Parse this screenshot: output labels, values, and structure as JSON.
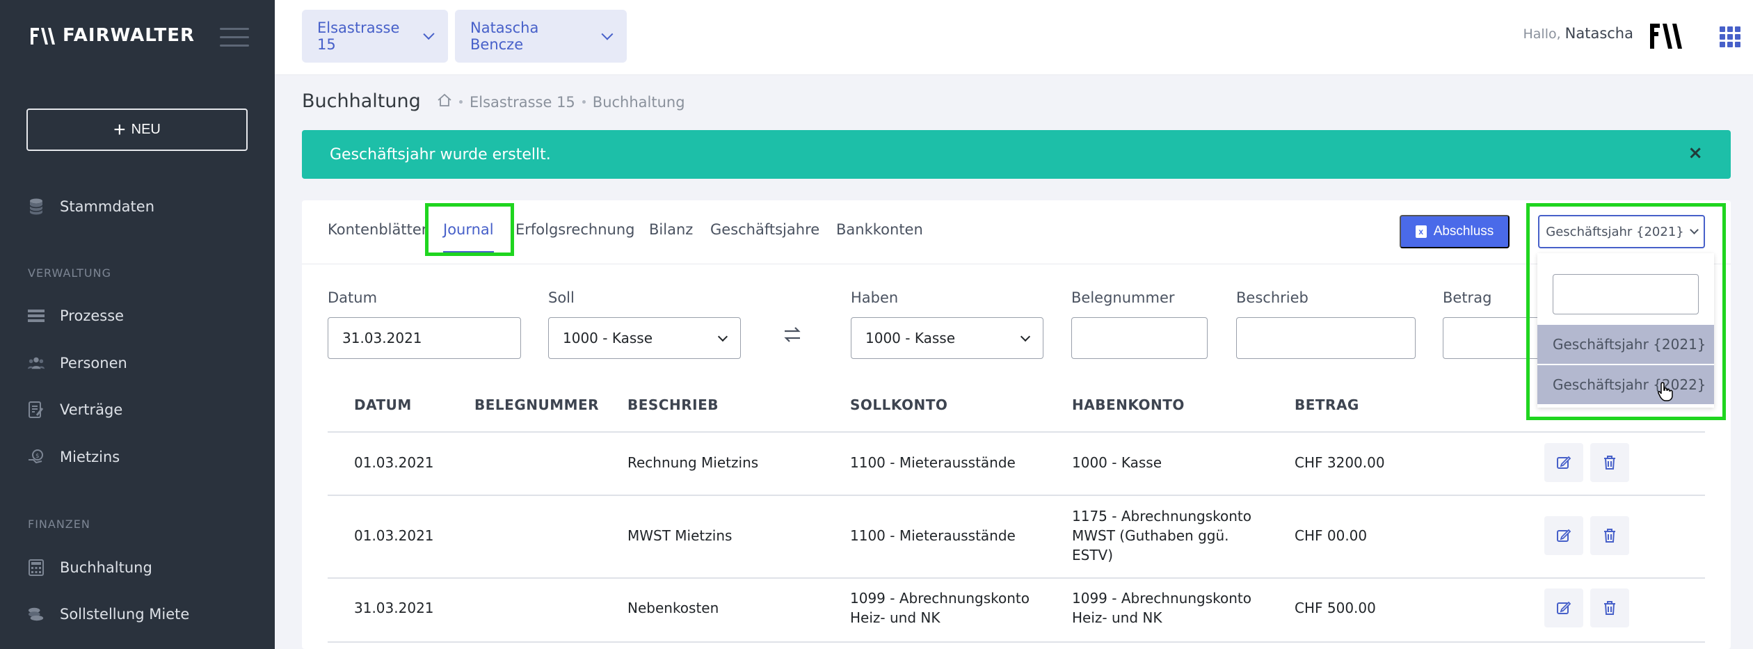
{
  "sidebar": {
    "logo": "FAIRWALTER",
    "new_label": "NEU",
    "items": [
      {
        "label": "Stammdaten",
        "icon": "database-icon"
      },
      {
        "label": "Prozesse",
        "icon": "list-icon"
      },
      {
        "label": "Personen",
        "icon": "people-icon"
      },
      {
        "label": "Verträge",
        "icon": "contract-icon"
      },
      {
        "label": "Mietzins",
        "icon": "coin-hand-icon"
      },
      {
        "label": "Buchhaltung",
        "icon": "calculator-icon"
      },
      {
        "label": "Sollstellung Miete",
        "icon": "coins-icon"
      }
    ],
    "sections": {
      "verwaltung": "VERWALTUNG",
      "finanzen": "FINANZEN"
    }
  },
  "topbar": {
    "property_select": "Elsastrasse 15",
    "person_select": "Natascha Bencze",
    "greeting": "Hallo,",
    "user_name": "Natascha"
  },
  "page": {
    "title": "Buchhaltung",
    "breadcrumb": [
      "Elsastrasse 15",
      "Buchhaltung"
    ]
  },
  "alert": {
    "message": "Geschäftsjahr wurde erstellt.",
    "close": "×",
    "color": "#1dbfa8"
  },
  "tabs": [
    "Kontenblätter",
    "Journal",
    "Erfolgsrechnung",
    "Bilanz",
    "Geschäftsjahre",
    "Bankkonten"
  ],
  "active_tab": "Journal",
  "actions": {
    "abschluss_label": "Abschluss",
    "fiscal_year_select": "Geschäftsjahr {2021}"
  },
  "form": {
    "datum_label": "Datum",
    "datum_value": "31.03.2021",
    "soll_label": "Soll",
    "soll_value": "1000 - Kasse",
    "haben_label": "Haben",
    "haben_value": "1000 - Kasse",
    "belegnummer_label": "Belegnummer",
    "beschrieb_label": "Beschrieb",
    "betrag_label": "Betrag"
  },
  "table": {
    "headers": [
      "DATUM",
      "BELEGNUMMER",
      "BESCHRIEB",
      "SOLLKONTO",
      "HABENKONTO",
      "BETRAG"
    ],
    "rows": [
      {
        "datum": "01.03.2021",
        "beleg": "",
        "beschrieb": "Rechnung Mietzins",
        "soll": [
          "1100 - Mieterausstände"
        ],
        "haben": [
          "1000 - Kasse"
        ],
        "betrag": "CHF 3200.00"
      },
      {
        "datum": "01.03.2021",
        "beleg": "",
        "beschrieb": "MWST Mietzins",
        "soll": [
          "1100 - Mieterausstände"
        ],
        "haben": [
          "1175 - Abrechnungskonto",
          "MWST (Guthaben ggü.",
          "ESTV)"
        ],
        "betrag": "CHF 00.00"
      },
      {
        "datum": "31.03.2021",
        "beleg": "",
        "beschrieb": "Nebenkosten",
        "soll": [
          "1099 - Abrechnungskonto",
          "Heiz- und NK"
        ],
        "haben": [
          "1099 - Abrechnungskonto",
          "Heiz- und NK"
        ],
        "betrag": "CHF 500.00"
      }
    ]
  },
  "dropdown": {
    "options": [
      "Geschäftsjahr {2021}",
      "Geschäftsjahr {2022}"
    ]
  },
  "colors": {
    "accent": "#4760c9",
    "highlight": "#1fd51f",
    "sidebar": "#2a323d"
  }
}
